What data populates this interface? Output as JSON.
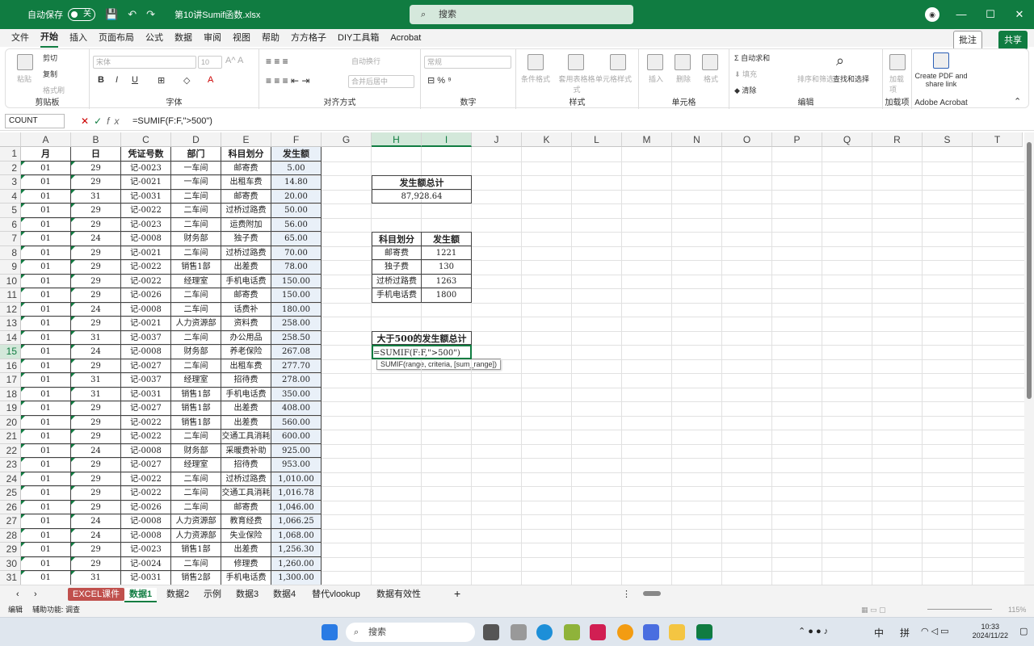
{
  "titlebar": {
    "autosave": "自动保存",
    "toggle": "关",
    "doc_title": "第10讲Sumif函数.xlsx",
    "search_placeholder": "搜索"
  },
  "menu": {
    "tabs": [
      "文件",
      "开始",
      "插入",
      "页面布局",
      "公式",
      "数据",
      "审阅",
      "视图",
      "帮助",
      "方方格子",
      "DIY工具箱",
      "Acrobat"
    ],
    "comment": "批注",
    "share": "共享"
  },
  "ribbon": {
    "clipboard": {
      "label": "剪贴板",
      "paste": "粘贴",
      "cut": "剪切",
      "copy": "复制",
      "format_painter": "格式刷"
    },
    "font": {
      "label": "字体",
      "font_name": "宋体",
      "font_size": "10"
    },
    "align": {
      "label": "对齐方式",
      "wrap": "自动换行",
      "merge": "合并后居中"
    },
    "number": {
      "label": "数字",
      "format": "常规"
    },
    "styles": {
      "label": "样式",
      "cond": "条件格式",
      "table": "套用表格格式",
      "cell": "单元格样式"
    },
    "cells": {
      "label": "单元格",
      "insert": "插入",
      "delete": "删除",
      "format": "格式"
    },
    "edit": {
      "label": "编辑",
      "autosum": "自动求和",
      "fill": "填充",
      "clear": "清除",
      "sort": "排序和筛选",
      "find": "查找和选择"
    },
    "addins": {
      "label": "加载项",
      "btn": "加载项"
    },
    "acrobat": {
      "label": "Adobe Acrobat",
      "btn": "Create PDF and share link"
    }
  },
  "formula": {
    "namebox": "COUNT",
    "fx": "fx",
    "text": "=SUMIF(F:F,\">500\")"
  },
  "columns": [
    "A",
    "B",
    "C",
    "D",
    "E",
    "F",
    "G",
    "H",
    "I",
    "J",
    "K",
    "L",
    "M",
    "N",
    "O",
    "P",
    "Q",
    "R",
    "S",
    "T"
  ],
  "headers": [
    "月",
    "日",
    "凭证号数",
    "部门",
    "科目划分",
    "发生额"
  ],
  "rows": [
    [
      "01",
      "29",
      "记-0023",
      "一车间",
      "邮寄费",
      "5.00"
    ],
    [
      "01",
      "29",
      "记-0021",
      "一车间",
      "出租车费",
      "14.80"
    ],
    [
      "01",
      "31",
      "记-0031",
      "二车间",
      "邮寄费",
      "20.00"
    ],
    [
      "01",
      "29",
      "记-0022",
      "二车间",
      "过桥过路费",
      "50.00"
    ],
    [
      "01",
      "29",
      "记-0023",
      "二车间",
      "运费附加",
      "56.00"
    ],
    [
      "01",
      "24",
      "记-0008",
      "财务部",
      "独子费",
      "65.00"
    ],
    [
      "01",
      "29",
      "记-0021",
      "二车间",
      "过桥过路费",
      "70.00"
    ],
    [
      "01",
      "29",
      "记-0022",
      "销售1部",
      "出差费",
      "78.00"
    ],
    [
      "01",
      "29",
      "记-0022",
      "经理室",
      "手机电话费",
      "150.00"
    ],
    [
      "01",
      "29",
      "记-0026",
      "二车间",
      "邮寄费",
      "150.00"
    ],
    [
      "01",
      "24",
      "记-0008",
      "二车间",
      "话费补",
      "180.00"
    ],
    [
      "01",
      "29",
      "记-0021",
      "人力资源部",
      "资料费",
      "258.00"
    ],
    [
      "01",
      "31",
      "记-0037",
      "二车间",
      "办公用品",
      "258.50"
    ],
    [
      "01",
      "24",
      "记-0008",
      "财务部",
      "养老保险",
      "267.08"
    ],
    [
      "01",
      "29",
      "记-0027",
      "二车间",
      "出租车费",
      "277.70"
    ],
    [
      "01",
      "31",
      "记-0037",
      "经理室",
      "招待费",
      "278.00"
    ],
    [
      "01",
      "31",
      "记-0031",
      "销售1部",
      "手机电话费",
      "350.00"
    ],
    [
      "01",
      "29",
      "记-0027",
      "销售1部",
      "出差费",
      "408.00"
    ],
    [
      "01",
      "29",
      "记-0022",
      "销售1部",
      "出差费",
      "560.00"
    ],
    [
      "01",
      "29",
      "记-0022",
      "二车间",
      "交通工具消耗",
      "600.00"
    ],
    [
      "01",
      "24",
      "记-0008",
      "财务部",
      "采暖费补助",
      "925.00"
    ],
    [
      "01",
      "29",
      "记-0027",
      "经理室",
      "招待费",
      "953.00"
    ],
    [
      "01",
      "29",
      "记-0022",
      "二车间",
      "过桥过路费",
      "1,010.00"
    ],
    [
      "01",
      "29",
      "记-0022",
      "二车间",
      "交通工具消耗",
      "1,016.78"
    ],
    [
      "01",
      "29",
      "记-0026",
      "二车间",
      "邮寄费",
      "1,046.00"
    ],
    [
      "01",
      "24",
      "记-0008",
      "人力资源部",
      "教育经费",
      "1,066.25"
    ],
    [
      "01",
      "24",
      "记-0008",
      "人力资源部",
      "失业保险",
      "1,068.00"
    ],
    [
      "01",
      "29",
      "记-0023",
      "销售1部",
      "出差费",
      "1,256.30"
    ],
    [
      "01",
      "29",
      "记-0024",
      "二车间",
      "修理费",
      "1,260.00"
    ],
    [
      "01",
      "31",
      "记-0031",
      "销售2部",
      "手机电话费",
      "1,300.00"
    ]
  ],
  "summary": {
    "total_title": "发生额总计",
    "total_value": "87,928.64",
    "sub_headers": [
      "科目划分",
      "发生额"
    ],
    "sub_rows": [
      [
        "邮寄费",
        "1221"
      ],
      [
        "独子费",
        "130"
      ],
      [
        "过桥过路费",
        "1263"
      ],
      [
        "手机电话费",
        "1800"
      ]
    ],
    "over_title": "大于500的发生额总计",
    "editing": "=SUMIF(F:F,\">500\")",
    "tooltip": "SUMIF(range, criteria, [sum_range])"
  },
  "sheets": {
    "tabs": [
      "EXCEL课件",
      "数据1",
      "数据2",
      "示例",
      "数据3",
      "数据4",
      "替代vlookup",
      "数据有效性"
    ],
    "active": "数据1"
  },
  "status": {
    "mode": "编辑",
    "accessibility": "辅助功能: 调查",
    "zoom": "115%"
  },
  "taskbar": {
    "search": "搜索",
    "ime1": "中",
    "ime2": "拼",
    "time": "10:33",
    "date": "2024/11/22"
  }
}
